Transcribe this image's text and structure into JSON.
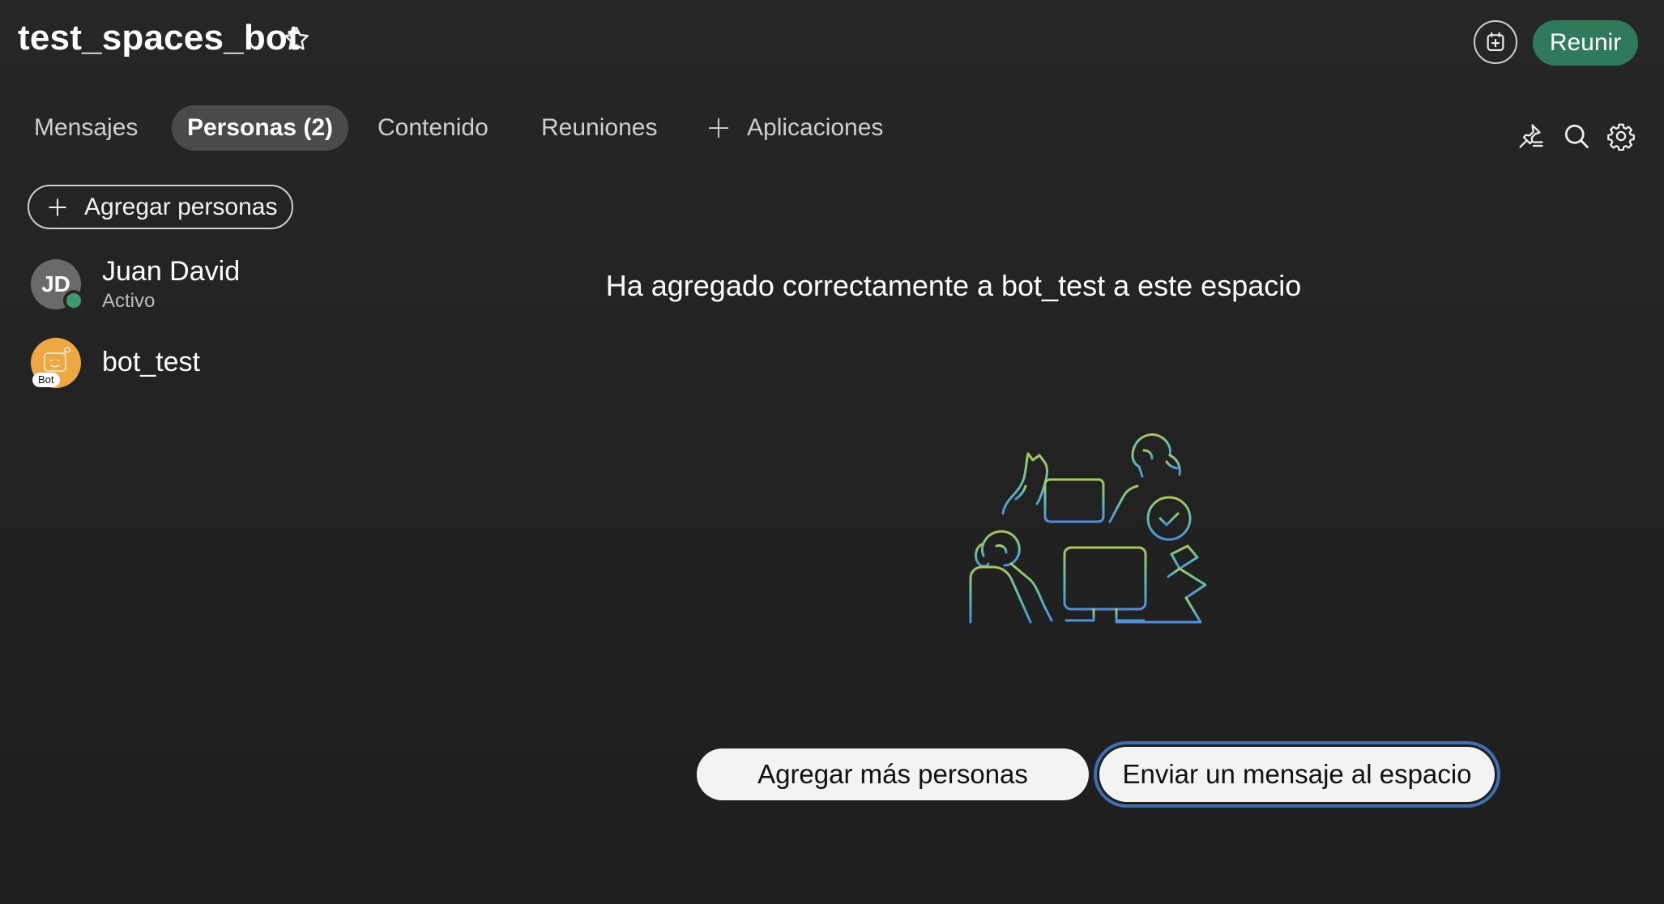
{
  "header": {
    "space_title": "test_spaces_bot",
    "meet_label": "Reunir"
  },
  "tabs": [
    {
      "label": "Mensajes",
      "active": false
    },
    {
      "label": "Personas (2)",
      "active": true
    },
    {
      "label": "Contenido",
      "active": false
    },
    {
      "label": "Reuniones",
      "active": false
    },
    {
      "label": "Aplicaciones",
      "active": false
    }
  ],
  "people_panel": {
    "add_button_label": "Agregar personas",
    "members": [
      {
        "initials": "JD",
        "name": "Juan David",
        "status": "Activo"
      },
      {
        "name": "bot_test",
        "badge": "Bot"
      }
    ]
  },
  "main": {
    "headline": "Ha agregado correctamente a bot_test a este espacio",
    "add_more_label": "Agregar más personas",
    "send_message_label": "Enviar un mensaje al espacio"
  },
  "colors": {
    "background": "#242424",
    "accent_green": "#2f7a5a",
    "presence_green": "#3d9a6d",
    "bot_avatar": "#eea843",
    "focus_ring": "#3e6fb0"
  },
  "icons": [
    "star-icon",
    "add-to-calendar-icon",
    "plus-icon",
    "pin-list-icon",
    "search-icon",
    "settings-gear-icon"
  ]
}
